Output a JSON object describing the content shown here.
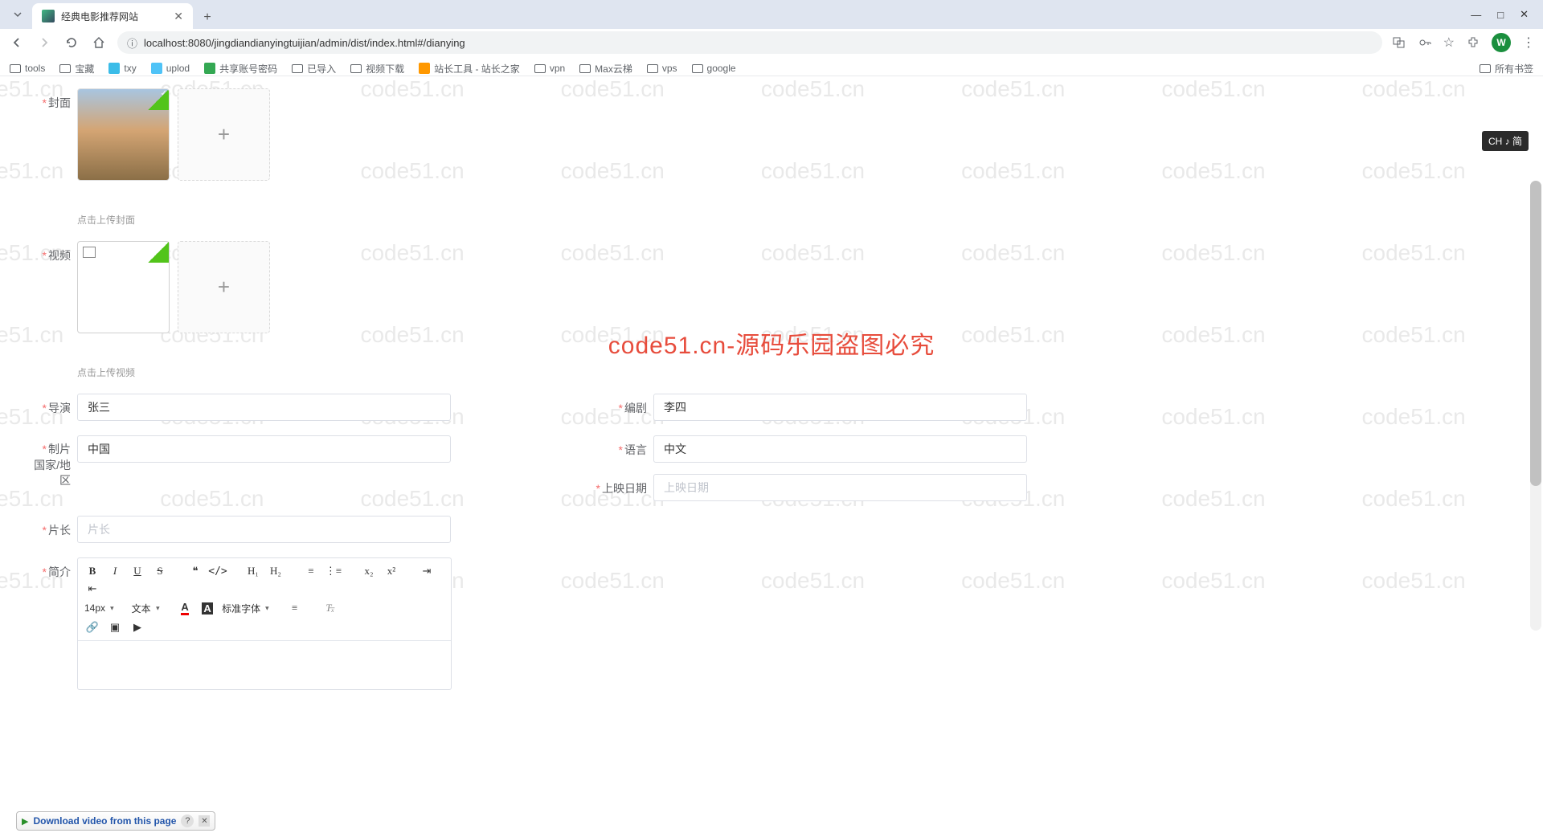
{
  "browser": {
    "tab_title": "经典电影推荐网站",
    "url": "localhost:8080/jingdiandianyingtuijian/admin/dist/index.html#/dianying",
    "avatar_initial": "W",
    "window": {
      "min": "—",
      "max": "□",
      "close": "✕"
    }
  },
  "bookmarks": {
    "items": [
      "tools",
      "宝藏",
      "txy",
      "uplod",
      "共享账号密码",
      "已导入",
      "视频下载",
      "站长工具 - 站长之家",
      "vpn",
      "Max云梯",
      "vps",
      "google"
    ],
    "all": "所有书签"
  },
  "watermark": {
    "text": "code51.cn",
    "center": "code51.cn-源码乐园盗图必究"
  },
  "ime": "CH ♪ 简",
  "form": {
    "cover": {
      "label": "封面",
      "hint": "点击上传封面"
    },
    "video": {
      "label": "视频",
      "hint": "点击上传视频"
    },
    "director": {
      "label": "导演",
      "value": "张三"
    },
    "writer": {
      "label": "编剧",
      "value": "李四"
    },
    "country": {
      "label": "制片国家/地区",
      "value": "中国"
    },
    "language": {
      "label": "语言",
      "value": "中文"
    },
    "release": {
      "label": "上映日期",
      "placeholder": "上映日期"
    },
    "duration": {
      "label": "片长",
      "placeholder": "片长"
    },
    "intro": {
      "label": "简介"
    }
  },
  "editor": {
    "font_size": "14px",
    "format": "文本",
    "font_family": "标准字体"
  },
  "download_bar": {
    "text": "Download video from this page",
    "help": "?",
    "close": "✕"
  }
}
